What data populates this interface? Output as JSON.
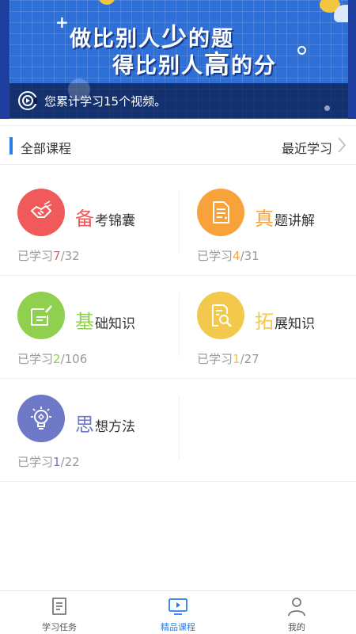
{
  "banner": {
    "slogan_line1_a": "做比别人",
    "slogan_line1_big": "少",
    "slogan_line1_b": "的题",
    "slogan_line2_a": "得比别人",
    "slogan_line2_big": "高",
    "slogan_line2_b": "的分",
    "caption": "您累计学习15个视频。"
  },
  "section": {
    "title": "全部课程",
    "recent_label": "最近学习"
  },
  "colors": {
    "accent": "#2b7de9",
    "red": "#f05a5a",
    "orange": "#f7a23a",
    "green": "#8fd04e",
    "yellow": "#f2c94c",
    "purple": "#6d78c6"
  },
  "courses": [
    {
      "first": "备",
      "rest": "考锦囊",
      "prefix": "已学习",
      "done": "7",
      "total": "/32",
      "color": "#f05a5a",
      "icon": "handshake-icon"
    },
    {
      "first": "真",
      "rest": "题讲解",
      "prefix": "已学习",
      "done": "4",
      "total": "/31",
      "color": "#f7a23a",
      "icon": "document-icon"
    },
    {
      "first": "基",
      "rest": "础知识",
      "prefix": "已学习",
      "done": "2",
      "total": "/106",
      "color": "#8fd04e",
      "icon": "edit-icon"
    },
    {
      "first": "拓",
      "rest": "展知识",
      "prefix": "已学习",
      "done": "1",
      "total": "/27",
      "color": "#f2c94c",
      "icon": "search-document-icon"
    },
    {
      "first": "思",
      "rest": "想方法",
      "prefix": "已学习",
      "done": "1",
      "total": "/22",
      "color": "#6d78c6",
      "icon": "lightbulb-icon"
    }
  ],
  "nav": [
    {
      "label": "学习任务",
      "icon": "task-icon"
    },
    {
      "label": "精品课程",
      "icon": "video-icon",
      "active": true
    },
    {
      "label": "我的",
      "icon": "user-icon"
    }
  ]
}
